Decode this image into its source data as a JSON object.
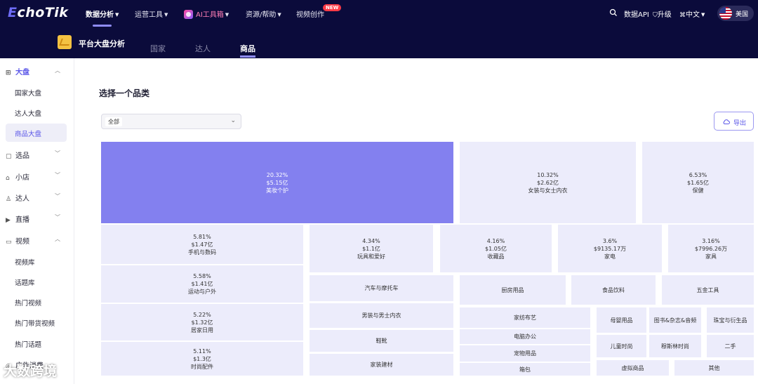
{
  "app": {
    "logo_prefix": "E",
    "logo_rest": "choTik"
  },
  "topnav": {
    "items": [
      {
        "label": "数据分析"
      },
      {
        "label": "运营工具"
      },
      {
        "label": "AI工具箱"
      },
      {
        "label": "资源/帮助"
      },
      {
        "label": "视频创作"
      }
    ],
    "new_badge": "NEW",
    "data_api": "数据API",
    "upgrade": "升级",
    "language": "中文",
    "region": "美国"
  },
  "subnav": {
    "title": "平台大盘分析",
    "tabs": [
      {
        "label": "国家"
      },
      {
        "label": "达人"
      },
      {
        "label": "商品"
      }
    ]
  },
  "sidebar": {
    "groups": [
      {
        "label": "大盘",
        "subs": [
          "国家大盘",
          "达人大盘",
          "商品大盘"
        ]
      },
      {
        "label": "选品"
      },
      {
        "label": "小店"
      },
      {
        "label": "达人"
      },
      {
        "label": "直播"
      },
      {
        "label": "视频",
        "subs": [
          "视频库",
          "话题库",
          "热门视频",
          "热门带货视频",
          "热门话题"
        ]
      },
      {
        "label": "广告消费"
      }
    ],
    "active_sub": "商品大盘"
  },
  "watermark": "大数跨境",
  "main": {
    "title": "选择一个品类",
    "select_value": "全部",
    "export_label": "导出"
  },
  "treemap": [
    {
      "pct": "20.32%",
      "value": "$5.15亿",
      "name": "美妆个护"
    },
    {
      "pct": "10.32%",
      "value": "$2.62亿",
      "name": "女装与女士内衣"
    },
    {
      "pct": "6.53%",
      "value": "$1.65亿",
      "name": "保健"
    },
    {
      "pct": "5.81%",
      "value": "$1.47亿",
      "name": "手机与数码"
    },
    {
      "pct": "4.34%",
      "value": "$1.1亿",
      "name": "玩具和爱好"
    },
    {
      "pct": "4.16%",
      "value": "$1.05亿",
      "name": "收藏品"
    },
    {
      "pct": "3.6%",
      "value": "$9135.17万",
      "name": "家电"
    },
    {
      "pct": "3.16%",
      "value": "$7996.26万",
      "name": "家具"
    },
    {
      "pct": "5.58%",
      "value": "$1.41亿",
      "name": "运动与户外"
    },
    {
      "pct": "5.22%",
      "value": "$1.32亿",
      "name": "居家日用"
    },
    {
      "pct": "5.11%",
      "value": "$1.3亿",
      "name": "时尚配件"
    },
    {
      "name": "汽车与摩托车"
    },
    {
      "name": "男装与男士内衣"
    },
    {
      "name": "鞋靴"
    },
    {
      "name": "家装建材"
    },
    {
      "name": "厨房用品"
    },
    {
      "name": "食品饮料"
    },
    {
      "name": "五金工具"
    },
    {
      "name": "家纺布艺"
    },
    {
      "name": "电脑办公"
    },
    {
      "name": "宠物用品"
    },
    {
      "name": "箱包"
    },
    {
      "name": "母婴用品"
    },
    {
      "name": "图书&杂志&音频"
    },
    {
      "name": "珠宝与衍生品"
    },
    {
      "name": "儿童时尚"
    },
    {
      "name": "穆斯林时尚"
    },
    {
      "name": "二手"
    },
    {
      "name": "虚拟商品"
    },
    {
      "name": "其他"
    }
  ],
  "colors": {
    "nav_bg": "#0b0b3b",
    "accent": "#5b57e8",
    "tile_top": "#8380ef",
    "tile": "#ececfb"
  },
  "icons": [
    "search-icon",
    "shield-icon",
    "translate-icon",
    "chevron-down-icon",
    "cloud-export-icon",
    "us-flag-icon"
  ]
}
